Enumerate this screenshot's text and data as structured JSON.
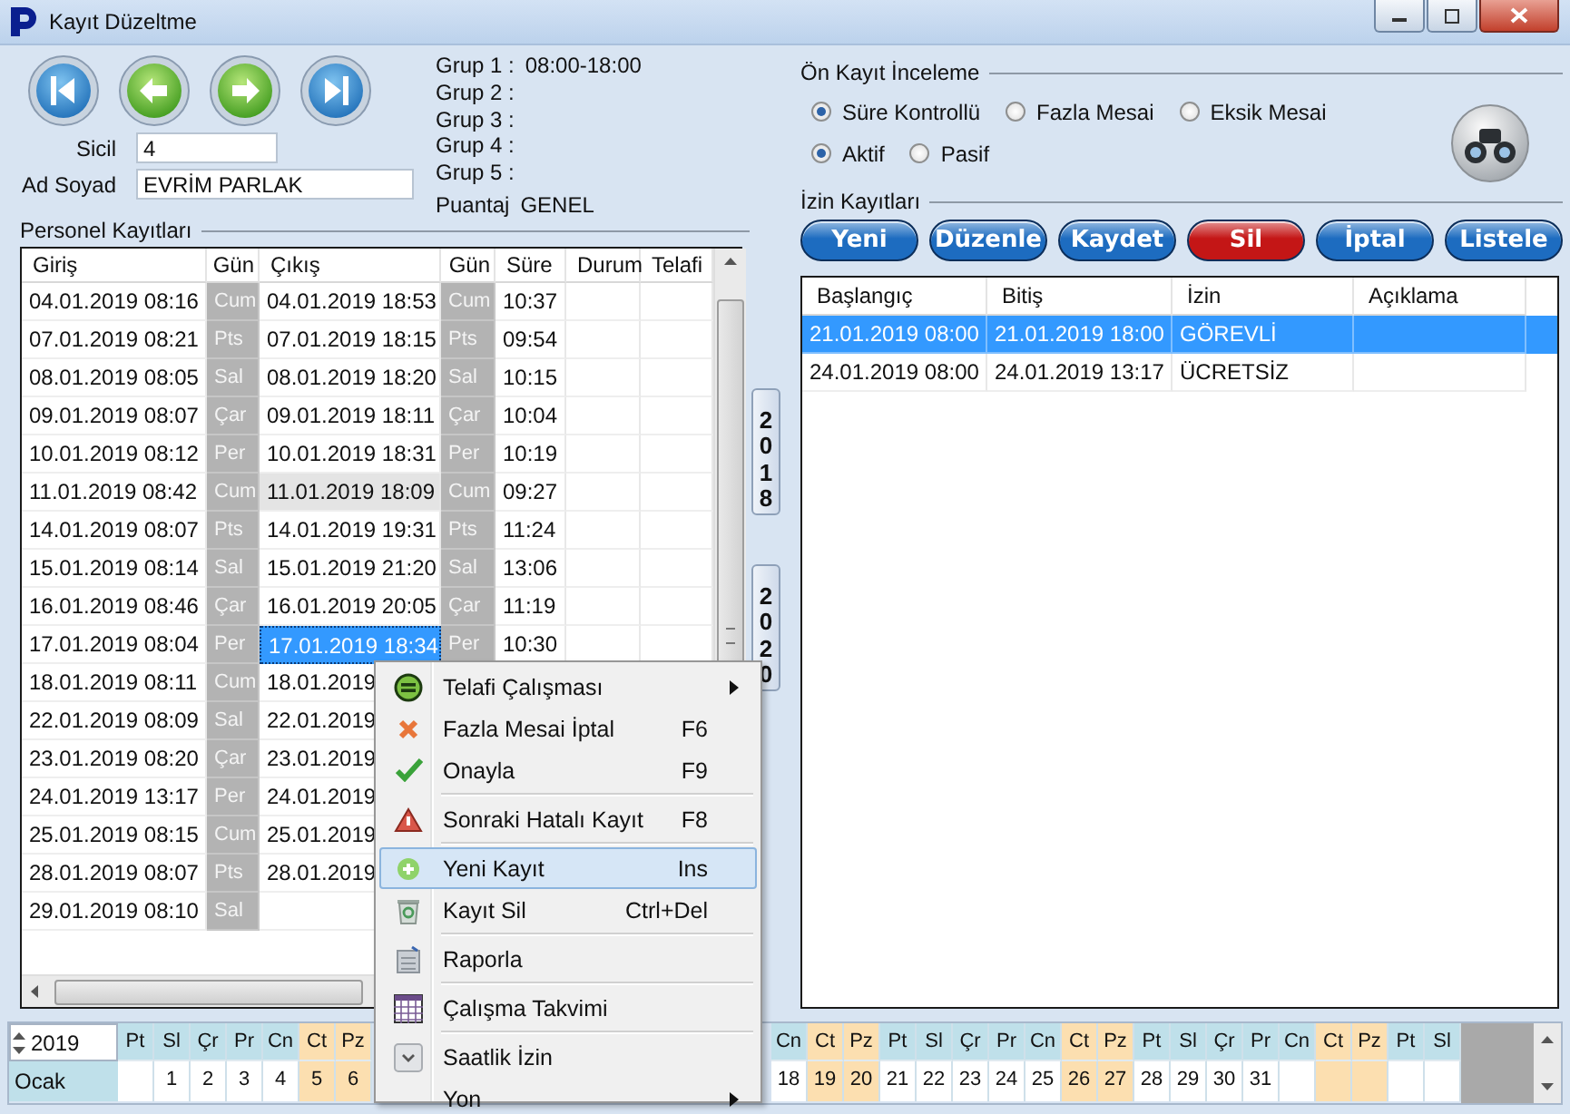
{
  "window": {
    "title": "Kayıt Düzeltme"
  },
  "employee": {
    "sicil_label": "Sicil",
    "sicil": "4",
    "name_label": "Ad Soyad",
    "name": "EVRİM PARLAK"
  },
  "groups": [
    {
      "label": "Grup 1 :",
      "value": "08:00-18:00"
    },
    {
      "label": "Grup 2 :"
    },
    {
      "label": "Grup 3 :"
    },
    {
      "label": "Grup 4 :"
    },
    {
      "label": "Grup 5 :"
    }
  ],
  "puantaj": {
    "label": "Puantaj",
    "value": "GENEL"
  },
  "personnel": {
    "title": "Personel Kayıtları",
    "columns": [
      "Giriş",
      "Gün",
      "Çıkış",
      "Gün",
      "Süre",
      "Durum",
      "Telafi"
    ],
    "rows": [
      {
        "entry": "04.01.2019 08:16",
        "entry_day": "Cum",
        "exit": "04.01.2019 18:53",
        "exit_day": "Cum",
        "duration": "10:37",
        "exit_selected": false,
        "exit_highlighted": false
      },
      {
        "entry": "07.01.2019 08:21",
        "entry_day": "Pts",
        "exit": "07.01.2019 18:15",
        "exit_day": "Pts",
        "duration": "09:54",
        "exit_selected": false,
        "exit_highlighted": false
      },
      {
        "entry": "08.01.2019 08:05",
        "entry_day": "Sal",
        "exit": "08.01.2019 18:20",
        "exit_day": "Sal",
        "duration": "10:15",
        "exit_selected": false,
        "exit_highlighted": false
      },
      {
        "entry": "09.01.2019 08:07",
        "entry_day": "Çar",
        "exit": "09.01.2019 18:11",
        "exit_day": "Çar",
        "duration": "10:04",
        "exit_selected": false,
        "exit_highlighted": false
      },
      {
        "entry": "10.01.2019 08:12",
        "entry_day": "Per",
        "exit": "10.01.2019 18:31",
        "exit_day": "Per",
        "duration": "10:19",
        "exit_selected": false,
        "exit_highlighted": false
      },
      {
        "entry": "11.01.2019 08:42",
        "entry_day": "Cum",
        "exit": "11.01.2019 18:09",
        "exit_day": "Cum",
        "duration": "09:27",
        "exit_selected": false,
        "exit_highlighted": true
      },
      {
        "entry": "14.01.2019 08:07",
        "entry_day": "Pts",
        "exit": "14.01.2019 19:31",
        "exit_day": "Pts",
        "duration": "11:24",
        "exit_selected": false,
        "exit_highlighted": false
      },
      {
        "entry": "15.01.2019 08:14",
        "entry_day": "Sal",
        "exit": "15.01.2019 21:20",
        "exit_day": "Sal",
        "duration": "13:06",
        "exit_selected": false,
        "exit_highlighted": false
      },
      {
        "entry": "16.01.2019 08:46",
        "entry_day": "Çar",
        "exit": "16.01.2019 20:05",
        "exit_day": "Çar",
        "duration": "11:19",
        "exit_selected": false,
        "exit_highlighted": false
      },
      {
        "entry": "17.01.2019 08:04",
        "entry_day": "Per",
        "exit": "17.01.2019 18:34",
        "exit_day": "Per",
        "duration": "10:30",
        "exit_selected": true,
        "exit_highlighted": false
      },
      {
        "entry": "18.01.2019 08:11",
        "entry_day": "Cum",
        "exit": "18.01.2019",
        "exit_selected": false,
        "exit_highlighted": false
      },
      {
        "entry": "22.01.2019 08:09",
        "entry_day": "Sal",
        "exit": "22.01.2019",
        "exit_selected": false,
        "exit_highlighted": false
      },
      {
        "entry": "23.01.2019 08:20",
        "entry_day": "Çar",
        "exit": "23.01.2019",
        "exit_selected": false,
        "exit_highlighted": false
      },
      {
        "entry": "24.01.2019 13:17",
        "entry_day": "Per",
        "exit": "24.01.2019",
        "exit_selected": false,
        "exit_highlighted": false
      },
      {
        "entry": "25.01.2019 08:15",
        "entry_day": "Cum",
        "exit": "25.01.2019",
        "exit_selected": false,
        "exit_highlighted": false
      },
      {
        "entry": "28.01.2019 08:07",
        "entry_day": "Pts",
        "exit": "28.01.2019",
        "exit_selected": false,
        "exit_highlighted": false
      },
      {
        "entry": "29.01.2019 08:10",
        "entry_day": "Sal"
      }
    ]
  },
  "year_tabs": [
    "2018",
    "2020"
  ],
  "review": {
    "title": "Ön Kayıt İnceleme",
    "mode_options": [
      {
        "label": "Süre Kontrollü",
        "selected": true
      },
      {
        "label": "Fazla Mesai",
        "selected": false
      },
      {
        "label": "Eksik Mesai",
        "selected": false
      }
    ],
    "status_options": [
      {
        "label": "Aktif",
        "selected": true
      },
      {
        "label": "Pasif",
        "selected": false
      }
    ]
  },
  "leave": {
    "title": "İzin Kayıtları",
    "buttons": [
      {
        "label": "Yeni",
        "color": "#1d6cc0"
      },
      {
        "label": "Düzenle",
        "color": "#1d6cc0"
      },
      {
        "label": "Kaydet",
        "color": "#1d6cc0"
      },
      {
        "label": "Sil",
        "color": "#c41616"
      },
      {
        "label": "İptal",
        "color": "#1d6cc0"
      },
      {
        "label": "Listele",
        "color": "#1d6cc0"
      }
    ],
    "columns": [
      "Başlangıç",
      "Bitiş",
      "İzin",
      "Açıklama"
    ],
    "rows": [
      {
        "cells": [
          "21.01.2019 08:00",
          "21.01.2019 18:00",
          "GÖREVLİ"
        ],
        "selected": true
      },
      {
        "cells": [
          "24.01.2019 08:00",
          "24.01.2019 13:17",
          "ÜCRETSİZ"
        ],
        "selected": false
      }
    ]
  },
  "calendar": {
    "year": "2019",
    "month": "Ocak",
    "columns_before": [
      {
        "header": "Pt",
        "weekend": false
      },
      {
        "header": "Sl",
        "day": "1",
        "weekend": false
      },
      {
        "header": "Çr",
        "day": "2",
        "weekend": false
      },
      {
        "header": "Pr",
        "day": "3",
        "weekend": false
      },
      {
        "header": "Cn",
        "day": "4",
        "weekend": false
      },
      {
        "header": "Ct",
        "day": "5",
        "weekend": true
      },
      {
        "header": "Pz",
        "day": "6",
        "weekend": true
      }
    ],
    "columns_after": [
      {
        "header": "Cn",
        "day": "18",
        "weekend": false
      },
      {
        "header": "Ct",
        "day": "19",
        "weekend": true
      },
      {
        "header": "Pz",
        "day": "20",
        "weekend": true
      },
      {
        "header": "Pt",
        "day": "21",
        "weekend": false
      },
      {
        "header": "Sl",
        "day": "22",
        "weekend": false
      },
      {
        "header": "Çr",
        "day": "23",
        "weekend": false
      },
      {
        "header": "Pr",
        "day": "24",
        "weekend": false
      },
      {
        "header": "Cn",
        "day": "25",
        "weekend": false
      },
      {
        "header": "Ct",
        "day": "26",
        "weekend": true
      },
      {
        "header": "Pz",
        "day": "27",
        "weekend": true
      },
      {
        "header": "Pt",
        "day": "28",
        "weekend": false
      },
      {
        "header": "Sl",
        "day": "29",
        "weekend": false
      },
      {
        "header": "Çr",
        "day": "30",
        "weekend": false
      },
      {
        "header": "Pr",
        "day": "31",
        "weekend": false
      },
      {
        "header": "Cn",
        "weekend": false
      },
      {
        "header": "Ct",
        "weekend": true
      },
      {
        "header": "Pz",
        "weekend": true
      },
      {
        "header": "Pt",
        "weekend": false
      },
      {
        "header": "Sl",
        "weekend": false
      }
    ]
  },
  "context_menu": {
    "items": [
      {
        "label": "Telafi Çalışması",
        "submenu": true,
        "highlighted": false,
        "separator_after": false
      },
      {
        "label": "Fazla Mesai İptal",
        "shortcut": "F6",
        "submenu": false,
        "highlighted": false,
        "separator_after": false
      },
      {
        "label": "Onayla",
        "shortcut": "F9",
        "submenu": false,
        "highlighted": false,
        "separator_after": true
      },
      {
        "label": "Sonraki Hatalı Kayıt",
        "shortcut": "F8",
        "submenu": false,
        "highlighted": false,
        "separator_after": true
      },
      {
        "label": "Yeni Kayıt",
        "shortcut": "Ins",
        "submenu": false,
        "highlighted": true,
        "separator_after": false
      },
      {
        "label": "Kayıt Sil",
        "shortcut": "Ctrl+Del",
        "submenu": false,
        "highlighted": false,
        "separator_after": true
      },
      {
        "label": "Raporla",
        "submenu": false,
        "highlighted": false,
        "separator_after": true
      },
      {
        "label": "Çalışma Takvimi",
        "submenu": false,
        "highlighted": false,
        "separator_after": true
      },
      {
        "label": "Saatlik İzin",
        "submenu": false,
        "highlighted": false,
        "separator_after": false
      },
      {
        "label": "Yon",
        "submenu": true,
        "highlighted": false,
        "separator_after": false
      }
    ]
  }
}
